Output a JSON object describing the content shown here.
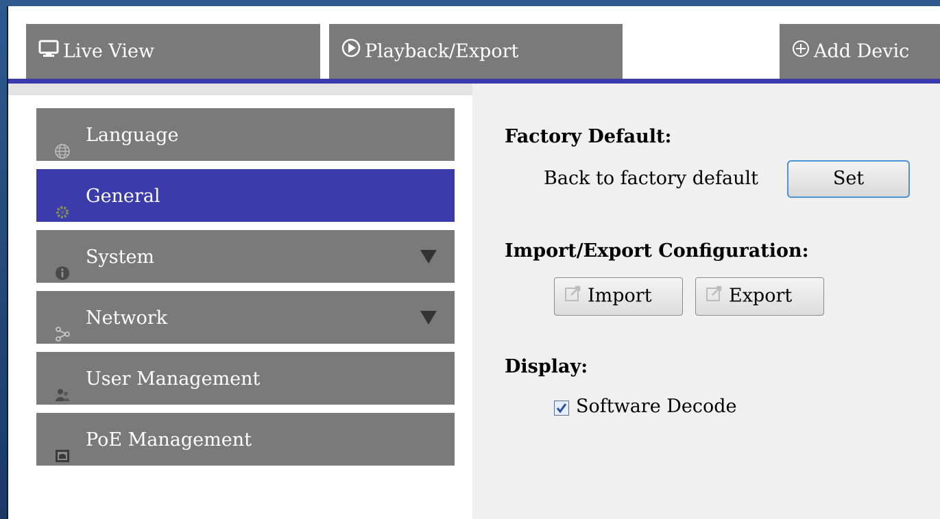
{
  "tabs": {
    "live_view": "Live View",
    "playback_export": "Playback/Export",
    "add_device": "Add Devic"
  },
  "sidebar": {
    "items": [
      {
        "label": "Language",
        "icon": "globe-icon"
      },
      {
        "label": "General",
        "icon": "gear-icon",
        "active": true
      },
      {
        "label": "System",
        "icon": "info-icon",
        "expandable": true
      },
      {
        "label": "Network",
        "icon": "network-icon",
        "expandable": true
      },
      {
        "label": "User Management",
        "icon": "users-icon"
      },
      {
        "label": "PoE Management",
        "icon": "poe-icon"
      }
    ]
  },
  "content": {
    "factory_default": {
      "heading": "Factory Default:",
      "label": "Back to factory default",
      "button": "Set"
    },
    "import_export": {
      "heading": "Import/Export Configuration:",
      "import_button": "Import",
      "export_button": "Export"
    },
    "display": {
      "heading": "Display:",
      "software_decode_label": "Software Decode",
      "software_decode_checked": true
    }
  },
  "colors": {
    "accent": "#3a3cab",
    "tab_bg": "#7a7a7a",
    "panel_bg": "#f0f0f0"
  }
}
